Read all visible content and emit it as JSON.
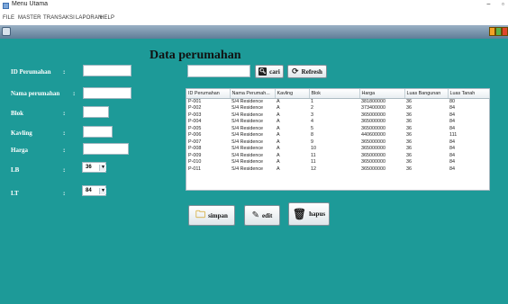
{
  "window": {
    "title": "Menu Utama",
    "minimize": "−",
    "maximize": "▫"
  },
  "menubar": [
    "FILE",
    "MASTER",
    "TRANSAKSI",
    "LAPORAN",
    "HELP"
  ],
  "form": {
    "heading": "Data perumahan",
    "colon": ":",
    "fields": {
      "id_perumahan": {
        "label": "ID Perumahan",
        "value": ""
      },
      "nama_perumahan": {
        "label": "Nama perumahan",
        "value": ""
      },
      "blok": {
        "label": "Blok",
        "value": ""
      },
      "kavling": {
        "label": "Kavling",
        "value": ""
      },
      "harga": {
        "label": "Harga",
        "value": ""
      },
      "lb": {
        "label": "LB",
        "value": "36"
      },
      "lt": {
        "label": "LT",
        "value": "84"
      }
    }
  },
  "search": {
    "value": "",
    "cari_label": "cari",
    "refresh_label": "Refresh"
  },
  "table": {
    "columns": [
      "ID Perumahan",
      "Nama Perumah...",
      "Kavling",
      "Blok",
      "Harga",
      "Luas Bangunan",
      "Luas Tanah"
    ],
    "rows": [
      [
        "P-001",
        "S/4 Residence",
        "A",
        "1",
        "381800000",
        "36",
        "80"
      ],
      [
        "P-002",
        "S/4 Residence",
        "A",
        "2",
        "373400000",
        "36",
        "84"
      ],
      [
        "P-003",
        "S/4 Residence",
        "A",
        "3",
        "365000000",
        "36",
        "84"
      ],
      [
        "P-004",
        "S/4 Residence",
        "A",
        "4",
        "365000000",
        "36",
        "84"
      ],
      [
        "P-005",
        "S/4 Residence",
        "A",
        "5",
        "365000000",
        "36",
        "84"
      ],
      [
        "P-006",
        "S/4 Residence",
        "A",
        "8",
        "440600000",
        "36",
        "111"
      ],
      [
        "P-007",
        "S/4 Residence",
        "A",
        "9",
        "365000000",
        "36",
        "84"
      ],
      [
        "P-008",
        "S/4 Residence",
        "A",
        "10",
        "365000000",
        "36",
        "84"
      ],
      [
        "P-009",
        "S/4 Residence",
        "A",
        "11",
        "365000000",
        "36",
        "84"
      ],
      [
        "P-010",
        "S/4 Residence",
        "A",
        "11",
        "365000000",
        "36",
        "84"
      ],
      [
        "P-011",
        "S/4 Residence",
        "A",
        "12",
        "365000000",
        "36",
        "84"
      ]
    ]
  },
  "actions": {
    "simpan": "simpan",
    "edit": "edit",
    "hapus": "hapus"
  },
  "colors": {
    "background": "#1d9a98",
    "title_gradient_top": "#9ab0c4",
    "title_gradient_bottom": "#5f7d98"
  }
}
